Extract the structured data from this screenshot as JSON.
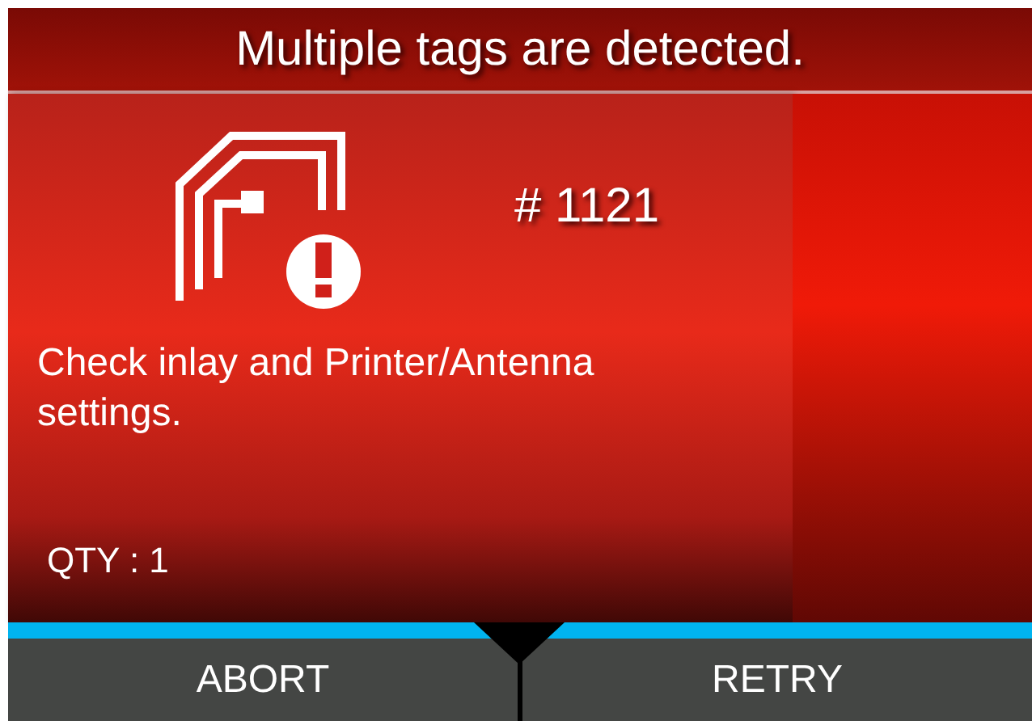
{
  "title": "Multiple tags are detected.",
  "error": {
    "code": "# 1121",
    "message": "Check inlay and Printer/Antenna settings.",
    "quantity": "QTY : 1"
  },
  "buttons": [
    {
      "label": "ABORT"
    },
    {
      "label": "RETRY"
    }
  ]
}
